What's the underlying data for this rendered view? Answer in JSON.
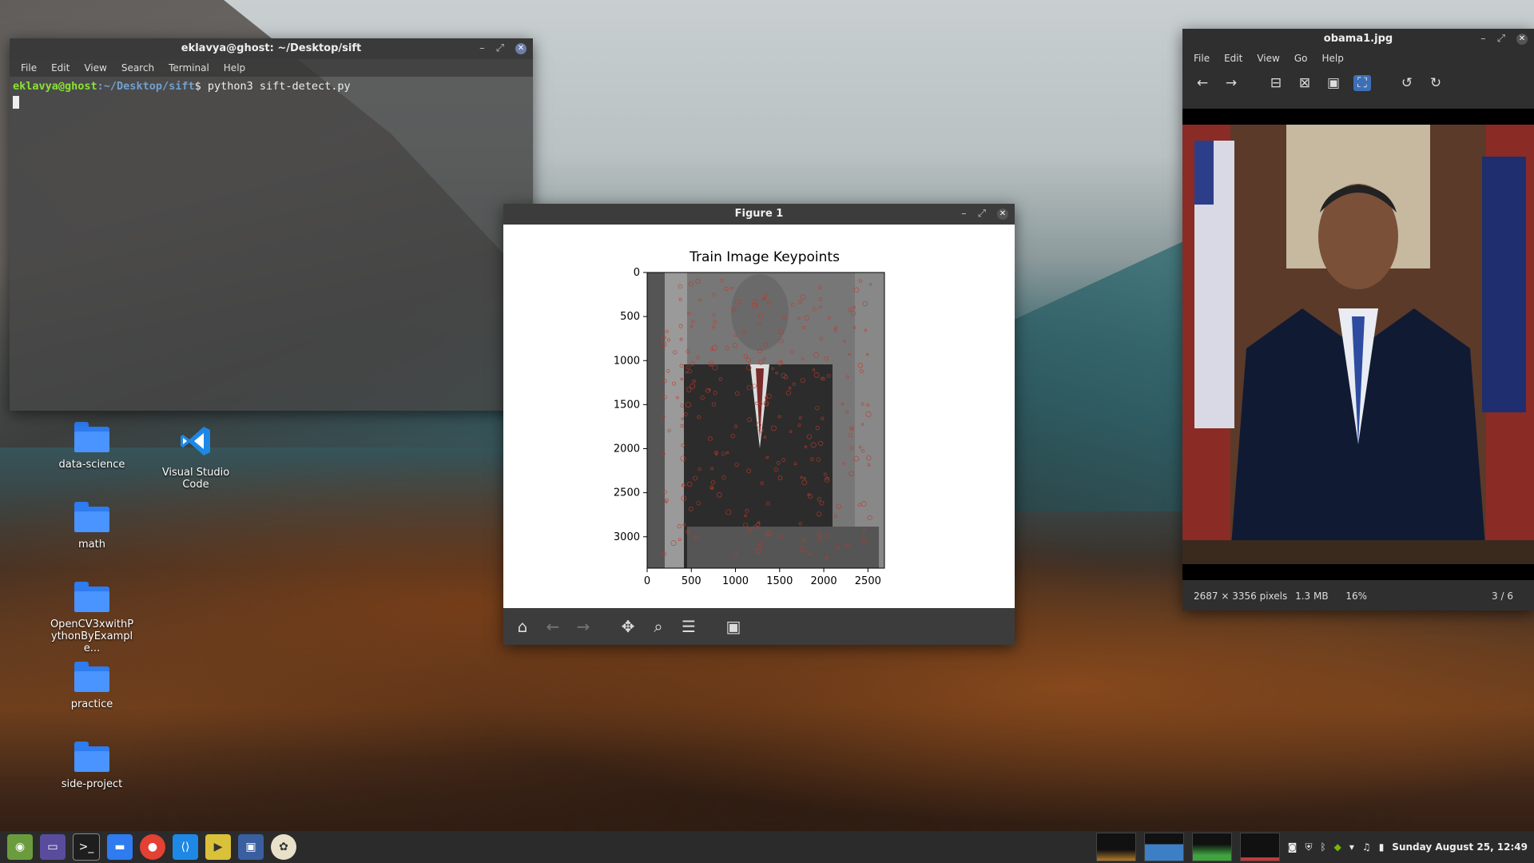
{
  "terminal": {
    "title": "eklavya@ghost: ~/Desktop/sift",
    "menu": [
      "File",
      "Edit",
      "View",
      "Search",
      "Terminal",
      "Help"
    ],
    "prompt_user": "eklavya@ghost",
    "prompt_path": ":~/Desktop/sift",
    "prompt_symbol": "$",
    "command": "python3 sift-detect.py"
  },
  "figure": {
    "title": "Figure 1",
    "chart_data": {
      "type": "image",
      "title": "Train Image Keypoints",
      "xticks": [
        "0",
        "500",
        "1000",
        "1500",
        "2000",
        "2500"
      ],
      "yticks": [
        "0",
        "500",
        "1000",
        "1500",
        "2000",
        "2500",
        "3000"
      ],
      "xlim": [
        0,
        2687
      ],
      "ylim": [
        3356,
        0
      ]
    },
    "toolbar_icons": [
      "home-icon",
      "back-icon",
      "forward-icon",
      "pan-icon",
      "zoom-icon",
      "configure-icon",
      "save-icon"
    ]
  },
  "viewer": {
    "title": "obama1.jpg",
    "menu": [
      "File",
      "Edit",
      "View",
      "Go",
      "Help"
    ],
    "status_dims": "2687 × 3356 pixels",
    "status_size": "1.3 MB",
    "status_zoom": "16%",
    "status_index": "3 / 6"
  },
  "desktop_icons": [
    {
      "label": "data-science"
    },
    {
      "label": "Visual Studio Code"
    },
    {
      "label": "math"
    },
    {
      "label": "OpenCV3xwithPythonByExample..."
    },
    {
      "label": "practice"
    },
    {
      "label": "side-project"
    }
  ],
  "taskbar": {
    "clock": "Sunday August 25, 12:49"
  },
  "colors": {
    "accent": "#3d6fb6",
    "folder": "#2f7bf0",
    "prompt_user": "#8ae234",
    "prompt_path": "#729fcf"
  }
}
